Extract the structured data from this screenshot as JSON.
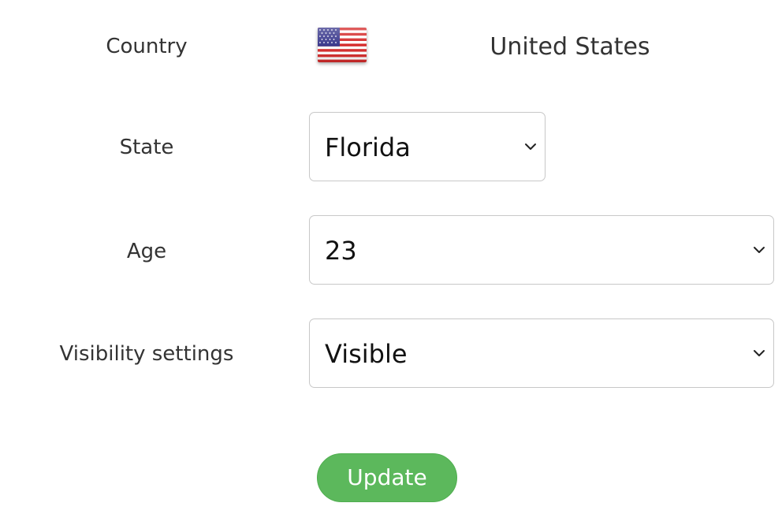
{
  "form": {
    "country": {
      "label": "Country",
      "value": "United States",
      "flag_icon": "us-flag-icon"
    },
    "state": {
      "label": "State",
      "selected": "Florida"
    },
    "age": {
      "label": "Age",
      "selected": "23"
    },
    "visibility": {
      "label": "Visibility settings",
      "selected": "Visible"
    },
    "update_label": "Update"
  },
  "colors": {
    "update_button": "#5cb85c",
    "text": "#333333",
    "select_border": "#c8c8c8"
  }
}
